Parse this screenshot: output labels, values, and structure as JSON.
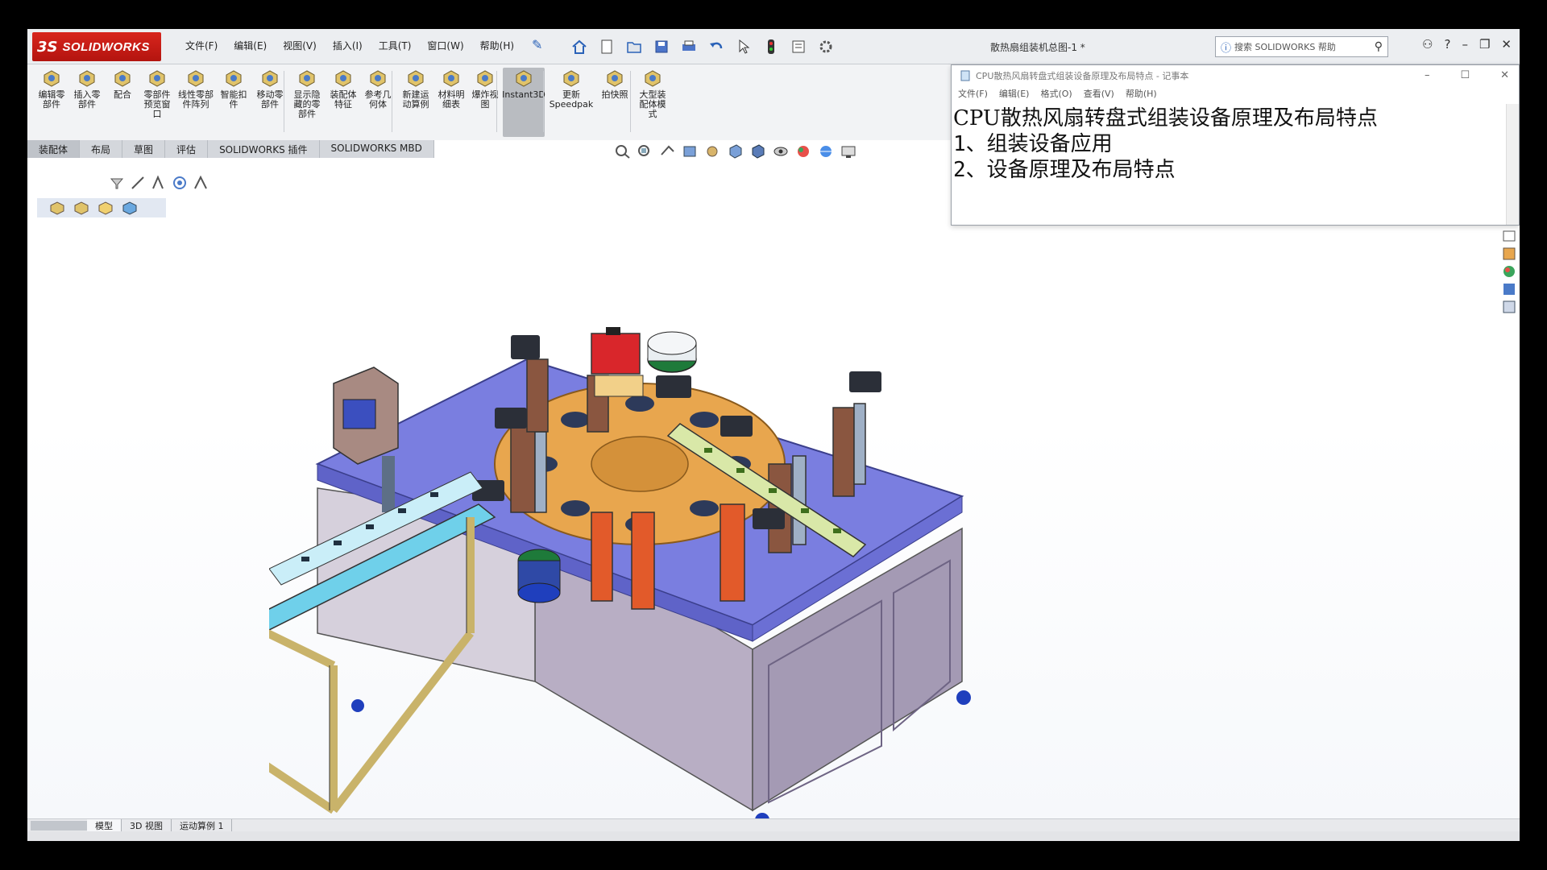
{
  "app": {
    "logo_ds": "3S",
    "logo_text": "SOLIDWORKS",
    "doc_title": "散热扇组装机总图-1 *",
    "search_placeholder": "搜索 SOLIDWORKS 帮助"
  },
  "menu": [
    "文件(F)",
    "编辑(E)",
    "视图(V)",
    "插入(I)",
    "工具(T)",
    "窗口(W)",
    "帮助(H)"
  ],
  "command_manager": {
    "buttons": [
      {
        "label": "编辑零\n部件",
        "icon": "edit-component-icon"
      },
      {
        "label": "插入零\n部件",
        "icon": "insert-component-icon"
      },
      {
        "label": "配合",
        "icon": "mate-icon"
      },
      {
        "label": "零部件\n预览窗\n口",
        "icon": "component-preview-icon"
      },
      {
        "label": "线性零部\n件阵列",
        "icon": "linear-pattern-icon"
      },
      {
        "label": "智能扣\n件",
        "icon": "smart-fastener-icon"
      },
      {
        "label": "移动零\n部件",
        "icon": "move-component-icon"
      },
      {
        "label": "显示隐\n藏的零\n部件",
        "icon": "show-hidden-icon"
      },
      {
        "label": "装配体\n特征",
        "icon": "assembly-feature-icon"
      },
      {
        "label": "参考几\n何体",
        "icon": "reference-geometry-icon"
      },
      {
        "label": "新建运\n动算例",
        "icon": "motion-study-icon"
      },
      {
        "label": "材料明\n细表",
        "icon": "bom-icon"
      },
      {
        "label": "爆炸视\n图",
        "icon": "exploded-view-icon"
      },
      {
        "label": "Instant3D",
        "icon": "instant3d-icon"
      },
      {
        "label": "更新\nSpeedpak",
        "icon": "speedpak-icon"
      },
      {
        "label": "拍快照",
        "icon": "snapshot-icon"
      },
      {
        "label": "大型装\n配体模\n式",
        "icon": "large-assembly-icon"
      }
    ],
    "tabs": [
      "装配体",
      "布局",
      "草图",
      "评估",
      "SOLIDWORKS 插件",
      "SOLIDWORKS MBD"
    ]
  },
  "bottom_tabs": [
    "模型",
    "3D 视图",
    "运动算例 1"
  ],
  "notepad": {
    "title": "CPU散热风扇转盘式组装设备原理及布局特点 - 记事本",
    "menu": [
      "文件(F)",
      "编辑(E)",
      "格式(O)",
      "查看(V)",
      "帮助(H)"
    ],
    "lines": [
      "CPU散热风扇转盘式组装设备原理及布局特点",
      "1、组装设备应用",
      "2、设备原理及布局特点"
    ]
  },
  "colors": {
    "brand_red": "#d8251d",
    "table_top": "#7a7ee0",
    "turntable": "#e8a64e",
    "frame_gold": "#c9b36a",
    "conveyor": "#6fd0ea",
    "cabinet": "#a89cb4"
  }
}
